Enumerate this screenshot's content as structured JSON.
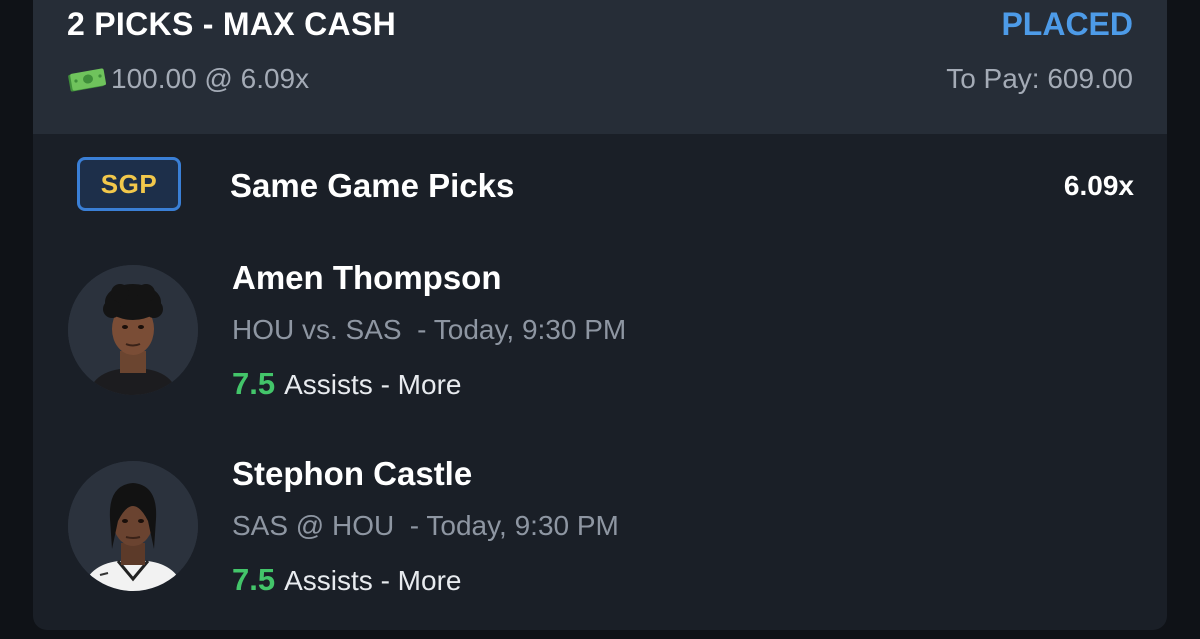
{
  "header": {
    "title": "2 PICKS - MAX CASH",
    "status": "PLACED",
    "wager": "100.00 @ 6.09x",
    "to_pay": "To Pay: 609.00",
    "status_color": "#4d9be8"
  },
  "sgp": {
    "badge": "SGP",
    "title": "Same Game Picks",
    "multiplier": "6.09x"
  },
  "picks": [
    {
      "player": "Amen Thompson",
      "matchup": "HOU vs. SAS",
      "time": "- Today, 9:30 PM",
      "line": "7.5",
      "stat": "Assists - More"
    },
    {
      "player": "Stephon Castle",
      "matchup": "SAS @ HOU",
      "time": "- Today, 9:30 PM",
      "line": "7.5",
      "stat": "Assists - More"
    }
  ],
  "colors": {
    "line_value": "#43c56a",
    "badge_text": "#f2c84b",
    "badge_border": "#3a7fd6"
  }
}
